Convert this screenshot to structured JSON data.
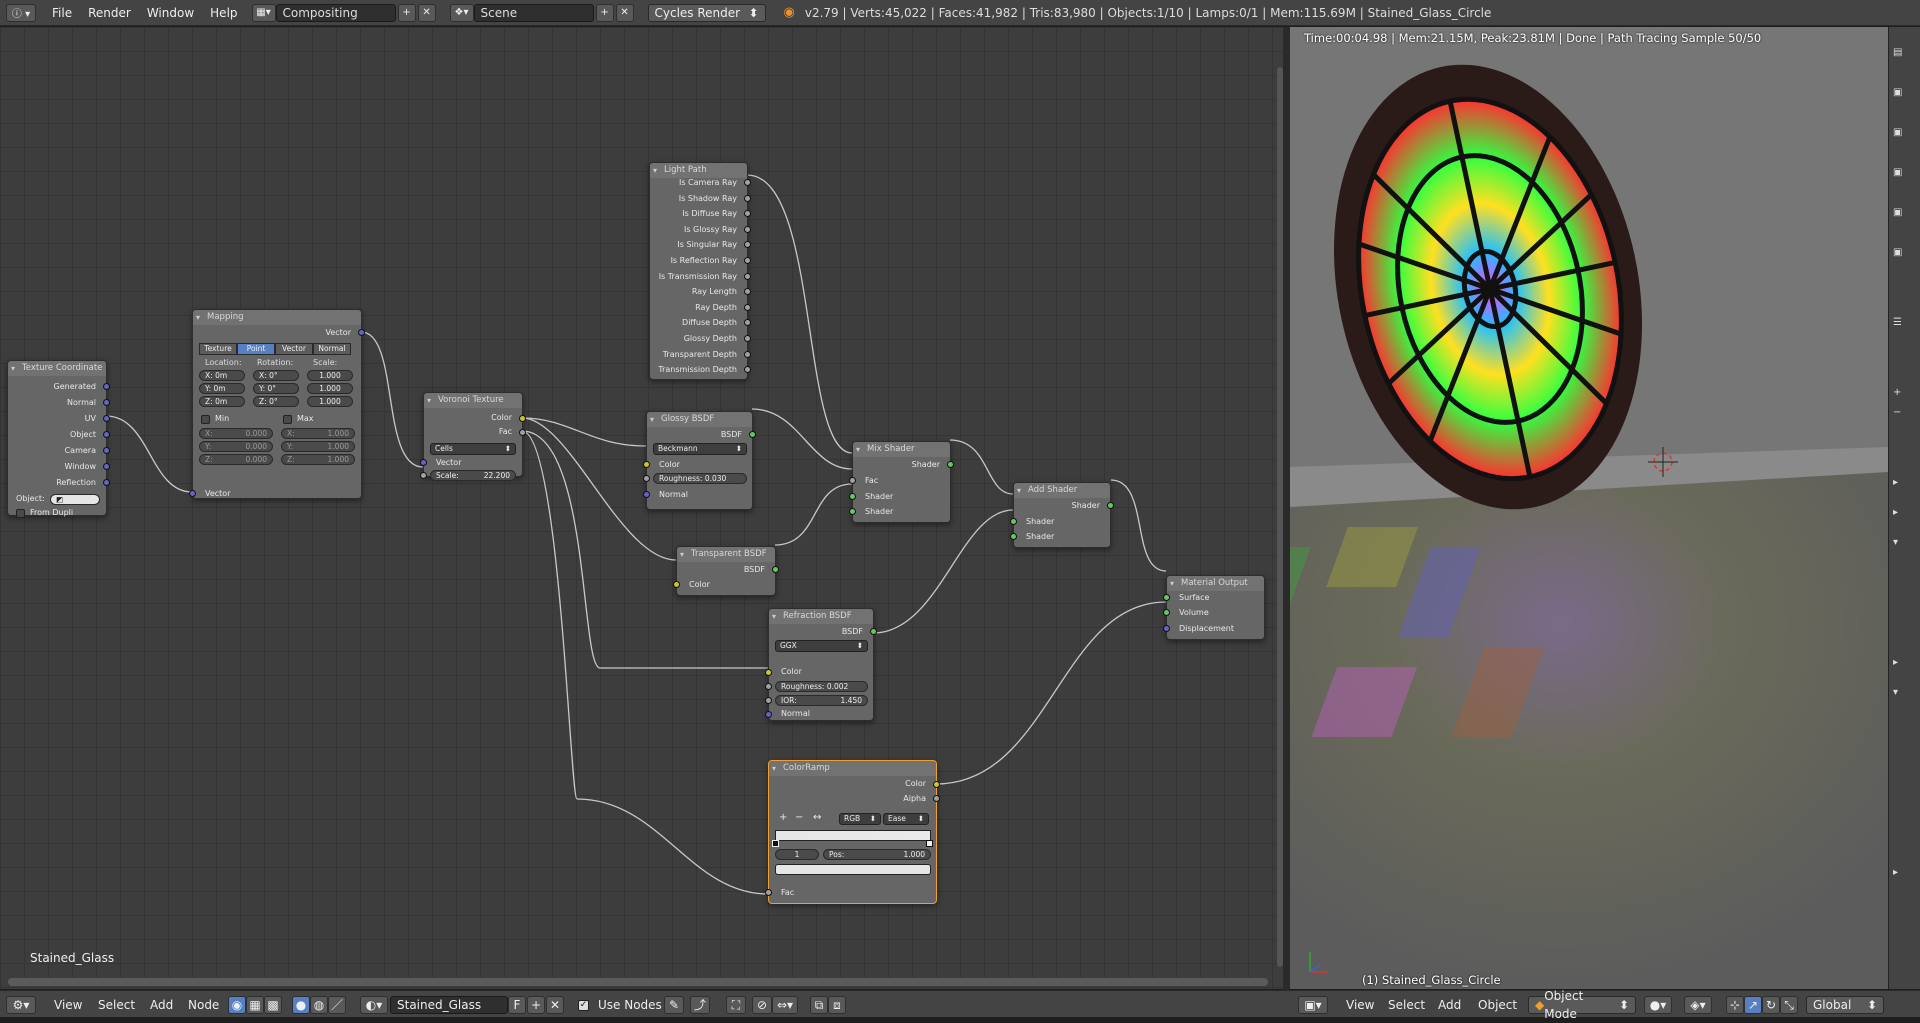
{
  "topbar": {
    "menus": [
      "File",
      "Render",
      "Window",
      "Help"
    ],
    "layout": "Compositing",
    "scene": "Scene",
    "engine": "Cycles Render",
    "stats": "v2.79 | Verts:45,022 | Faces:41,982 | Tris:83,980 | Objects:1/10 | Lamps:0/1 | Mem:115.69M | Stained_Glass_Circle"
  },
  "node_editor": {
    "tree_name": "Stained_Glass"
  },
  "nodes": {
    "texcoord": {
      "title": "Texture Coordinate",
      "outputs": [
        "Generated",
        "Normal",
        "UV",
        "Object",
        "Camera",
        "Window",
        "Reflection"
      ],
      "object_label": "Object:",
      "from_dupli": "From Dupli"
    },
    "mapping": {
      "title": "Mapping",
      "output": "Vector",
      "tabs": [
        "Texture",
        "Point",
        "Vector",
        "Normal"
      ],
      "active_tab": "Point",
      "headers": [
        "Location:",
        "Rotation:",
        "Scale:"
      ],
      "loc": [
        "X:",
        "0m",
        "Y:",
        "0m",
        "Z:",
        "0m"
      ],
      "rot": [
        "X:",
        "0°",
        "Y:",
        "0°",
        "Z:",
        "0°"
      ],
      "scale": [
        "1.000",
        "1.000",
        "1.000"
      ],
      "min": "Min",
      "max": "Max",
      "min_vals": [
        "X:",
        "0.000",
        "Y:",
        "0.000",
        "Z:",
        "0.000"
      ],
      "max_vals": [
        "X:",
        "1.000",
        "Y:",
        "1.000",
        "Z:",
        "1.000"
      ],
      "input": "Vector"
    },
    "voronoi": {
      "title": "Voronoi Texture",
      "outputs": [
        "Color",
        "Fac"
      ],
      "mode": "Cells",
      "input": "Vector",
      "scale_label": "Scale:",
      "scale": "22.200"
    },
    "lightpath": {
      "title": "Light Path",
      "outputs": [
        "Is Camera Ray",
        "Is Shadow Ray",
        "Is Diffuse Ray",
        "Is Glossy Ray",
        "Is Singular Ray",
        "Is Reflection Ray",
        "Is Transmission Ray",
        "Ray Length",
        "Ray Depth",
        "Diffuse Depth",
        "Glossy Depth",
        "Transparent Depth",
        "Transmission Depth"
      ]
    },
    "glossy": {
      "title": "Glossy BSDF",
      "output": "BSDF",
      "dist": "Beckmann",
      "inputs": [
        "Color",
        "Normal"
      ],
      "rough_label": "Roughness:",
      "rough": "0.030"
    },
    "transparent": {
      "title": "Transparent BSDF",
      "output": "BSDF",
      "input": "Color"
    },
    "mix": {
      "title": "Mix Shader",
      "output": "Shader",
      "inputs": [
        "Fac",
        "Shader",
        "Shader"
      ]
    },
    "add": {
      "title": "Add Shader",
      "output": "Shader",
      "inputs": [
        "Shader",
        "Shader"
      ]
    },
    "output": {
      "title": "Material Output",
      "inputs": [
        "Surface",
        "Volume",
        "Displacement"
      ]
    },
    "refraction": {
      "title": "Refraction BSDF",
      "output": "BSDF",
      "dist": "GGX",
      "inputs": [
        "Color",
        "Normal"
      ],
      "rough_label": "Roughness:",
      "rough": "0.002",
      "ior_label": "IOR:",
      "ior": "1.450"
    },
    "colorramp": {
      "title": "ColorRamp",
      "outputs": [
        "Color",
        "Alpha"
      ],
      "mode": "RGB",
      "interp": "Ease",
      "index": "1",
      "pos_label": "Pos:",
      "pos": "1.000",
      "input": "Fac",
      "plus": "+",
      "minus": "−",
      "flip": "↔"
    }
  },
  "viewport": {
    "render_stats": "Time:00:04.98 | Mem:21.15M, Peak:23.81M | Done | Path Tracing Sample 50/50",
    "object_name": "(1) Stained_Glass_Circle"
  },
  "bottombar": {
    "left": {
      "menus": [
        "View",
        "Select",
        "Add",
        "Node"
      ],
      "material": "Stained_Glass",
      "f_label": "F",
      "use_nodes": "Use Nodes"
    },
    "right": {
      "menus": [
        "View",
        "Select",
        "Add",
        "Object"
      ],
      "mode": "Object Mode",
      "orientation": "Global"
    }
  },
  "colors": {
    "vector_socket": "#6363c7",
    "color_socket": "#c7c729",
    "shader_socket": "#63c763",
    "value_socket": "#a1a1a1",
    "selected_outline": "#f0a030",
    "active_tab": "#5680c2"
  }
}
